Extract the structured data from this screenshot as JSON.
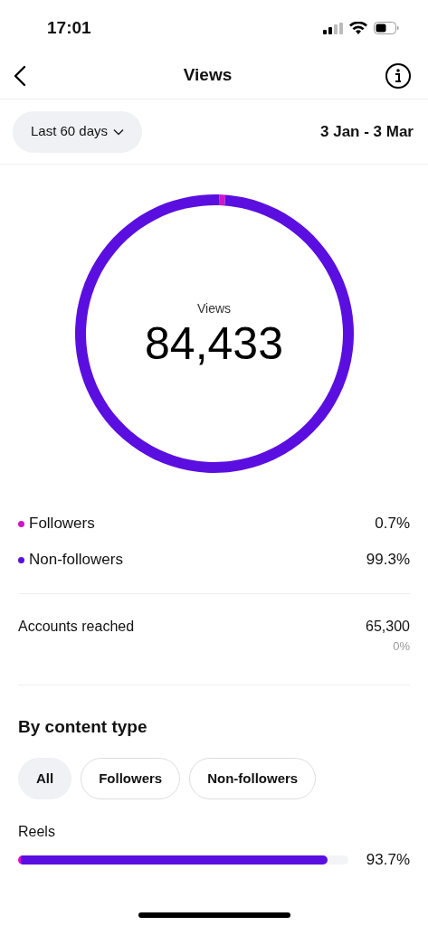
{
  "status_bar": {
    "time": "17:01"
  },
  "header": {
    "title": "Views"
  },
  "filter": {
    "range": "Last 60 days",
    "dates": "3 Jan - 3 Mar"
  },
  "donut": {
    "total": "84,433",
    "chart_data": {
      "type": "donut",
      "title": "Views",
      "categories": [
        "Followers",
        "Non-followers"
      ],
      "values": [
        0.7,
        99.3
      ]
    }
  },
  "legend": [
    {
      "value": "0.7%",
      "color": "#d214c8"
    },
    {
      "value": "99.3%",
      "color": "#5a0fe0"
    }
  ],
  "accounts": {
    "label": "Accounts reached",
    "value": "65,300",
    "change": "0%"
  },
  "content_type": {
    "title": "By content type",
    "chips": [
      {
        "label": "All",
        "selected": true
      },
      {
        "label": "Followers",
        "selected": false
      },
      {
        "label": "Non-followers",
        "selected": false
      }
    ],
    "rows": [
      {
        "label": "Reels",
        "level": 0.937,
        "value": "93.7%"
      }
    ]
  }
}
